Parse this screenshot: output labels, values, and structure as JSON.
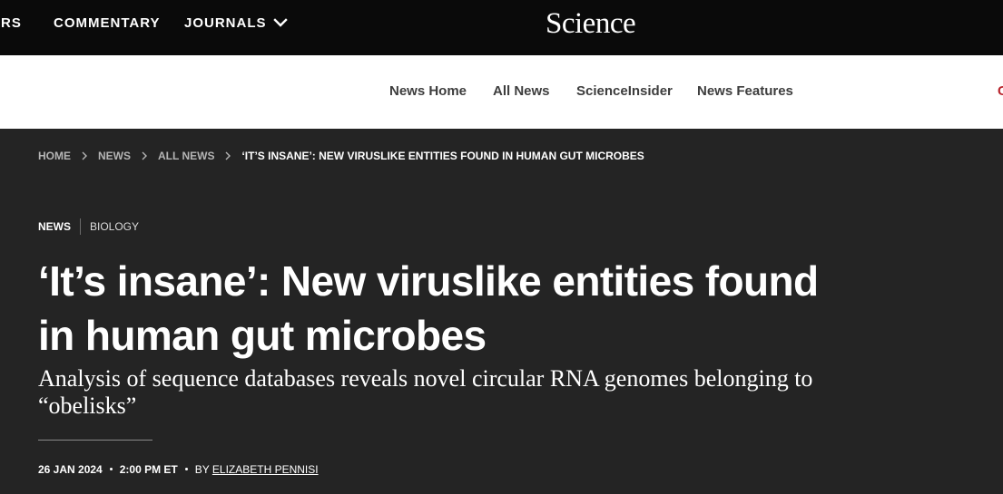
{
  "top_nav": {
    "partial_item": "ERS",
    "commentary": "COMMENTARY",
    "journals": "JOURNALS",
    "logo": "Science"
  },
  "sub_nav": {
    "items": [
      "News Home",
      "All News",
      "ScienceInsider",
      "News Features"
    ],
    "edge_text": "C"
  },
  "breadcrumb": {
    "items": [
      "HOME",
      "NEWS",
      "ALL NEWS"
    ],
    "current": "‘IT’S INSANE’: NEW VIRUSLIKE ENTITIES FOUND IN HUMAN GUT MICROBES"
  },
  "article": {
    "section": "NEWS",
    "topic": "BIOLOGY",
    "title": "‘It’s insane’: New viruslike entities found in human gut microbes",
    "subtitle": "Analysis of sequence databases reveals novel circular RNA genomes belonging to “obelisks”",
    "date": "26 Jan 2024",
    "time": "2:00 PM ET",
    "by": "By",
    "author": "Elizabeth Pennisi"
  },
  "colors": {
    "top_bar": "#0a0a0a",
    "sub_nav_bg": "#ffffff",
    "hero_bg": "#242424",
    "brand_red": "#b8232b"
  }
}
